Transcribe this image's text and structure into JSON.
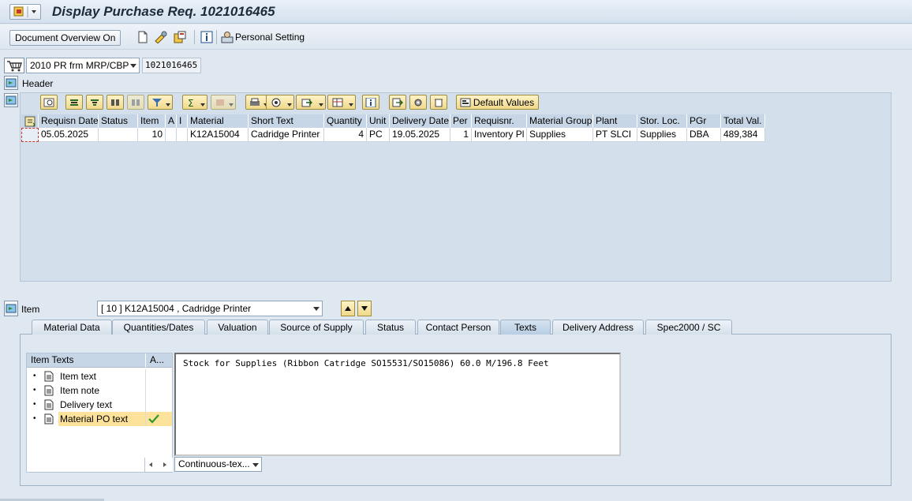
{
  "window": {
    "title": "Display Purchase Req. 1021016465"
  },
  "toolbar": {
    "document_overview_label": "Document Overview On",
    "personal_setting_label": "Personal Setting"
  },
  "header_line": {
    "doc_type": "2010 PR frm MRP/CBP",
    "pr_number": "1021016465",
    "header_label": "Header"
  },
  "grid": {
    "default_values_label": "Default Values",
    "columns": [
      "Requisn Date",
      "Status",
      "Item",
      "A",
      "I",
      "Material",
      "Short Text",
      "Quantity",
      "Unit",
      "Delivery Date",
      "Per",
      "Requisnr.",
      "Material Group",
      "Plant",
      "Stor. Loc.",
      "PGr",
      "Total Val."
    ],
    "rows": [
      [
        "05.05.2025",
        "",
        "10",
        "",
        "",
        "K12A15004",
        "Cadridge Printer",
        "4",
        "PC",
        "19.05.2025",
        "1",
        "Inventory Pl",
        "Supplies",
        "PT SLCI",
        "Supplies",
        "DBA",
        "489,384"
      ]
    ]
  },
  "item_line": {
    "label": "Item",
    "selected": "[ 10 ] K12A15004 , Cadridge Printer"
  },
  "tabs": [
    {
      "label": "Material Data"
    },
    {
      "label": "Quantities/Dates"
    },
    {
      "label": "Valuation"
    },
    {
      "label": "Source of Supply"
    },
    {
      "label": "Status"
    },
    {
      "label": "Contact Person"
    },
    {
      "label": "Texts"
    },
    {
      "label": "Delivery Address"
    },
    {
      "label": "Spec2000 / SC"
    }
  ],
  "active_tab": "Texts",
  "item_texts": {
    "header": "Item Texts",
    "col_a": "A...",
    "rows": [
      {
        "label": "Item text",
        "has_text": false
      },
      {
        "label": "Item note",
        "has_text": false
      },
      {
        "label": "Delivery text",
        "has_text": false
      },
      {
        "label": "Material PO text",
        "has_text": true
      }
    ],
    "editor_text": "Stock for Supplies (Ribbon Catridge SO15531/SO15086) 60.0 M/196.8 Feet",
    "format_select": "Continuous-tex..."
  },
  "colors": {
    "background": "#dfe8f1",
    "grid_button": "#f0d98c",
    "selection": "#fce29a",
    "check": "#2e9a2e"
  }
}
